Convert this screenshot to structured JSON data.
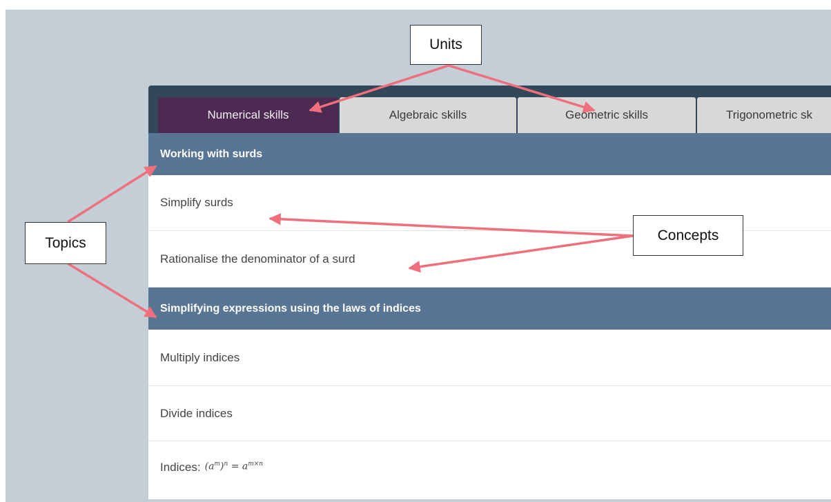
{
  "tabs": [
    {
      "label": "Numerical skills",
      "active": true
    },
    {
      "label": "Algebraic skills",
      "active": false
    },
    {
      "label": "Geometric skills",
      "active": false
    },
    {
      "label": "Trigonometric sk",
      "active": false
    }
  ],
  "topics": [
    {
      "title": "Working with surds",
      "concepts": [
        "Simplify surds",
        "Rationalise the denominator of a surd"
      ]
    },
    {
      "title": "Simplifying expressions using the laws of indices",
      "concepts": [
        "Multiply indices",
        "Divide indices",
        "Indices:"
      ]
    }
  ],
  "indices_formula": {
    "base": "a",
    "m": "m",
    "n": "n",
    "eq": "=",
    "exp": "m×n"
  },
  "callouts": {
    "units": "Units",
    "topics": "Topics",
    "concepts": "Concepts"
  },
  "colors": {
    "background": "#c4ced7",
    "panel": "#33475b",
    "active_tab": "#4d2a52",
    "inactive_tab": "#d8d8d8",
    "topic_header": "#587593",
    "arrow": "#ef6f7d"
  }
}
